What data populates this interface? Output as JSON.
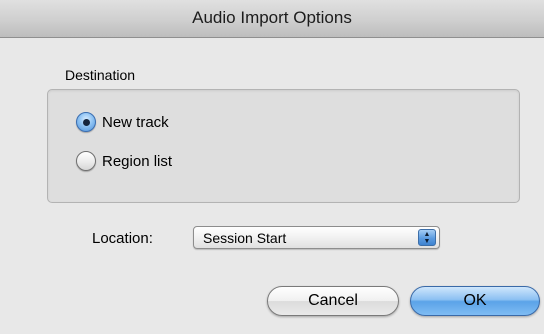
{
  "window": {
    "title": "Audio Import Options"
  },
  "destination": {
    "label": "Destination",
    "options": [
      {
        "label": "New track",
        "selected": true
      },
      {
        "label": "Region list",
        "selected": false
      }
    ]
  },
  "location": {
    "label": "Location:",
    "selected_value": "Session Start"
  },
  "buttons": {
    "cancel_label": "Cancel",
    "ok_label": "OK"
  },
  "colors": {
    "accent": "#5ba3e8",
    "background": "#e8e8e8"
  }
}
